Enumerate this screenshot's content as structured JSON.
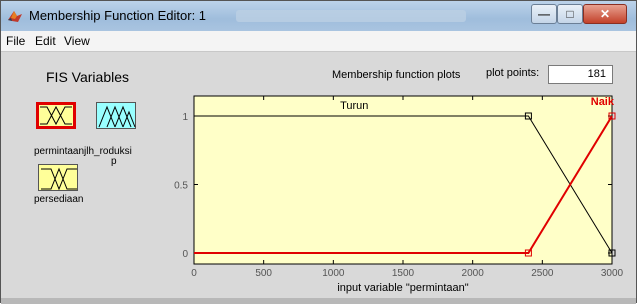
{
  "window": {
    "title": "Membership Function Editor: 1",
    "minimize_glyph": "—",
    "maximize_glyph": "□",
    "close_glyph": "✕"
  },
  "menu": {
    "file": "File",
    "edit": "Edit",
    "view": "View"
  },
  "fis_variables": {
    "heading": "FIS Variables",
    "inputs": [
      "permintaan",
      "persediaan"
    ],
    "outputs": [
      "jlh_produksi"
    ],
    "overlapping_label_text": "permintaanjlh_roduksi",
    "overlapping_label_subscript": "p",
    "selected": "permintaan",
    "colors": {
      "input_fill": "#ffff99",
      "output_fill": "#99ffff",
      "selected_border": "#e00000"
    }
  },
  "plot": {
    "panel_title": "Membership function plots",
    "plot_points_label": "plot points:",
    "plot_points_value": "181",
    "xlabel": "input variable \"permintaan\"",
    "background": "#ffffc8"
  },
  "chart_data": {
    "type": "line",
    "xlim": [
      0,
      3000
    ],
    "ylim": [
      0,
      1
    ],
    "x_ticks": [
      0,
      500,
      1000,
      1500,
      2000,
      2500,
      3000
    ],
    "y_ticks": [
      0,
      0.5,
      1
    ],
    "tick_labels": {
      "x": [
        "0",
        "500",
        "1000",
        "1500",
        "2000",
        "2500",
        "3000"
      ],
      "y": [
        "0",
        "0.5",
        "1"
      ]
    },
    "series": [
      {
        "name": "Turun",
        "x": [
          0,
          2400,
          3000
        ],
        "y": [
          1,
          1,
          0
        ],
        "color": "#000000",
        "selected": false
      },
      {
        "name": "Naik",
        "x": [
          0,
          2400,
          3000
        ],
        "y": [
          0,
          0,
          1
        ],
        "color": "#e00000",
        "selected": true
      }
    ]
  }
}
